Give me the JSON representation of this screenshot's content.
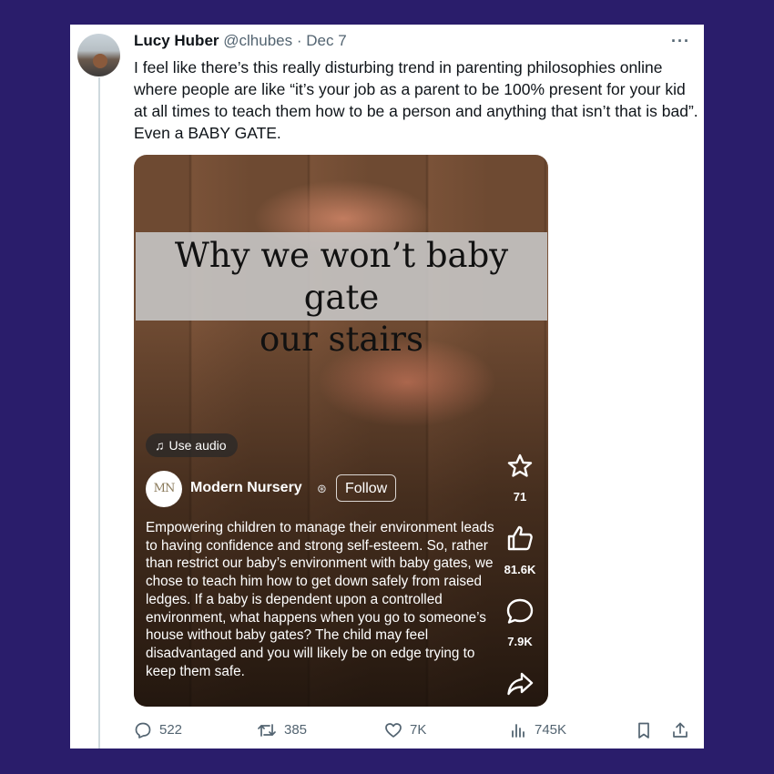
{
  "tweet": {
    "author_name": "Lucy Huber",
    "handle": "@clhubes",
    "separator": "·",
    "date": "Dec 7",
    "more_icon": "more-horizontal-icon",
    "text": "I feel like there’s this really disturbing trend in parenting philosophies online where people are like “it’s your job as a parent to be 100% present for your kid at all times to teach them how to be a person and anything that isn’t that is bad”. Even a BABY GATE."
  },
  "embedded_video": {
    "banner_line1": "Why we won’t baby gate",
    "banner_line2": "our stairs",
    "use_audio_label": "Use audio",
    "creator_logo_text": "MN",
    "creator_name": "Modern Nursery",
    "follow_label": "Follow",
    "caption": "Empowering children to manage their environment leads to having confidence and strong self-esteem. So, rather than restrict our baby’s environment with baby gates, we chose to teach him how to get down safely from raised ledges. If a baby is dependent upon a controlled environment, what happens when you go to someone’s house without baby gates? The child may feel disadvantaged and you will likely be on edge trying to keep them safe.",
    "rail": {
      "remix_count": "71",
      "like_count": "81.6K",
      "comment_count": "7.9K"
    }
  },
  "actions": {
    "replies": "522",
    "retweets": "385",
    "likes": "7K",
    "views": "745K"
  },
  "colors": {
    "background": "#2a1d6b",
    "card": "#ffffff",
    "muted_text": "#536471",
    "thread_line": "#cfd9de"
  }
}
